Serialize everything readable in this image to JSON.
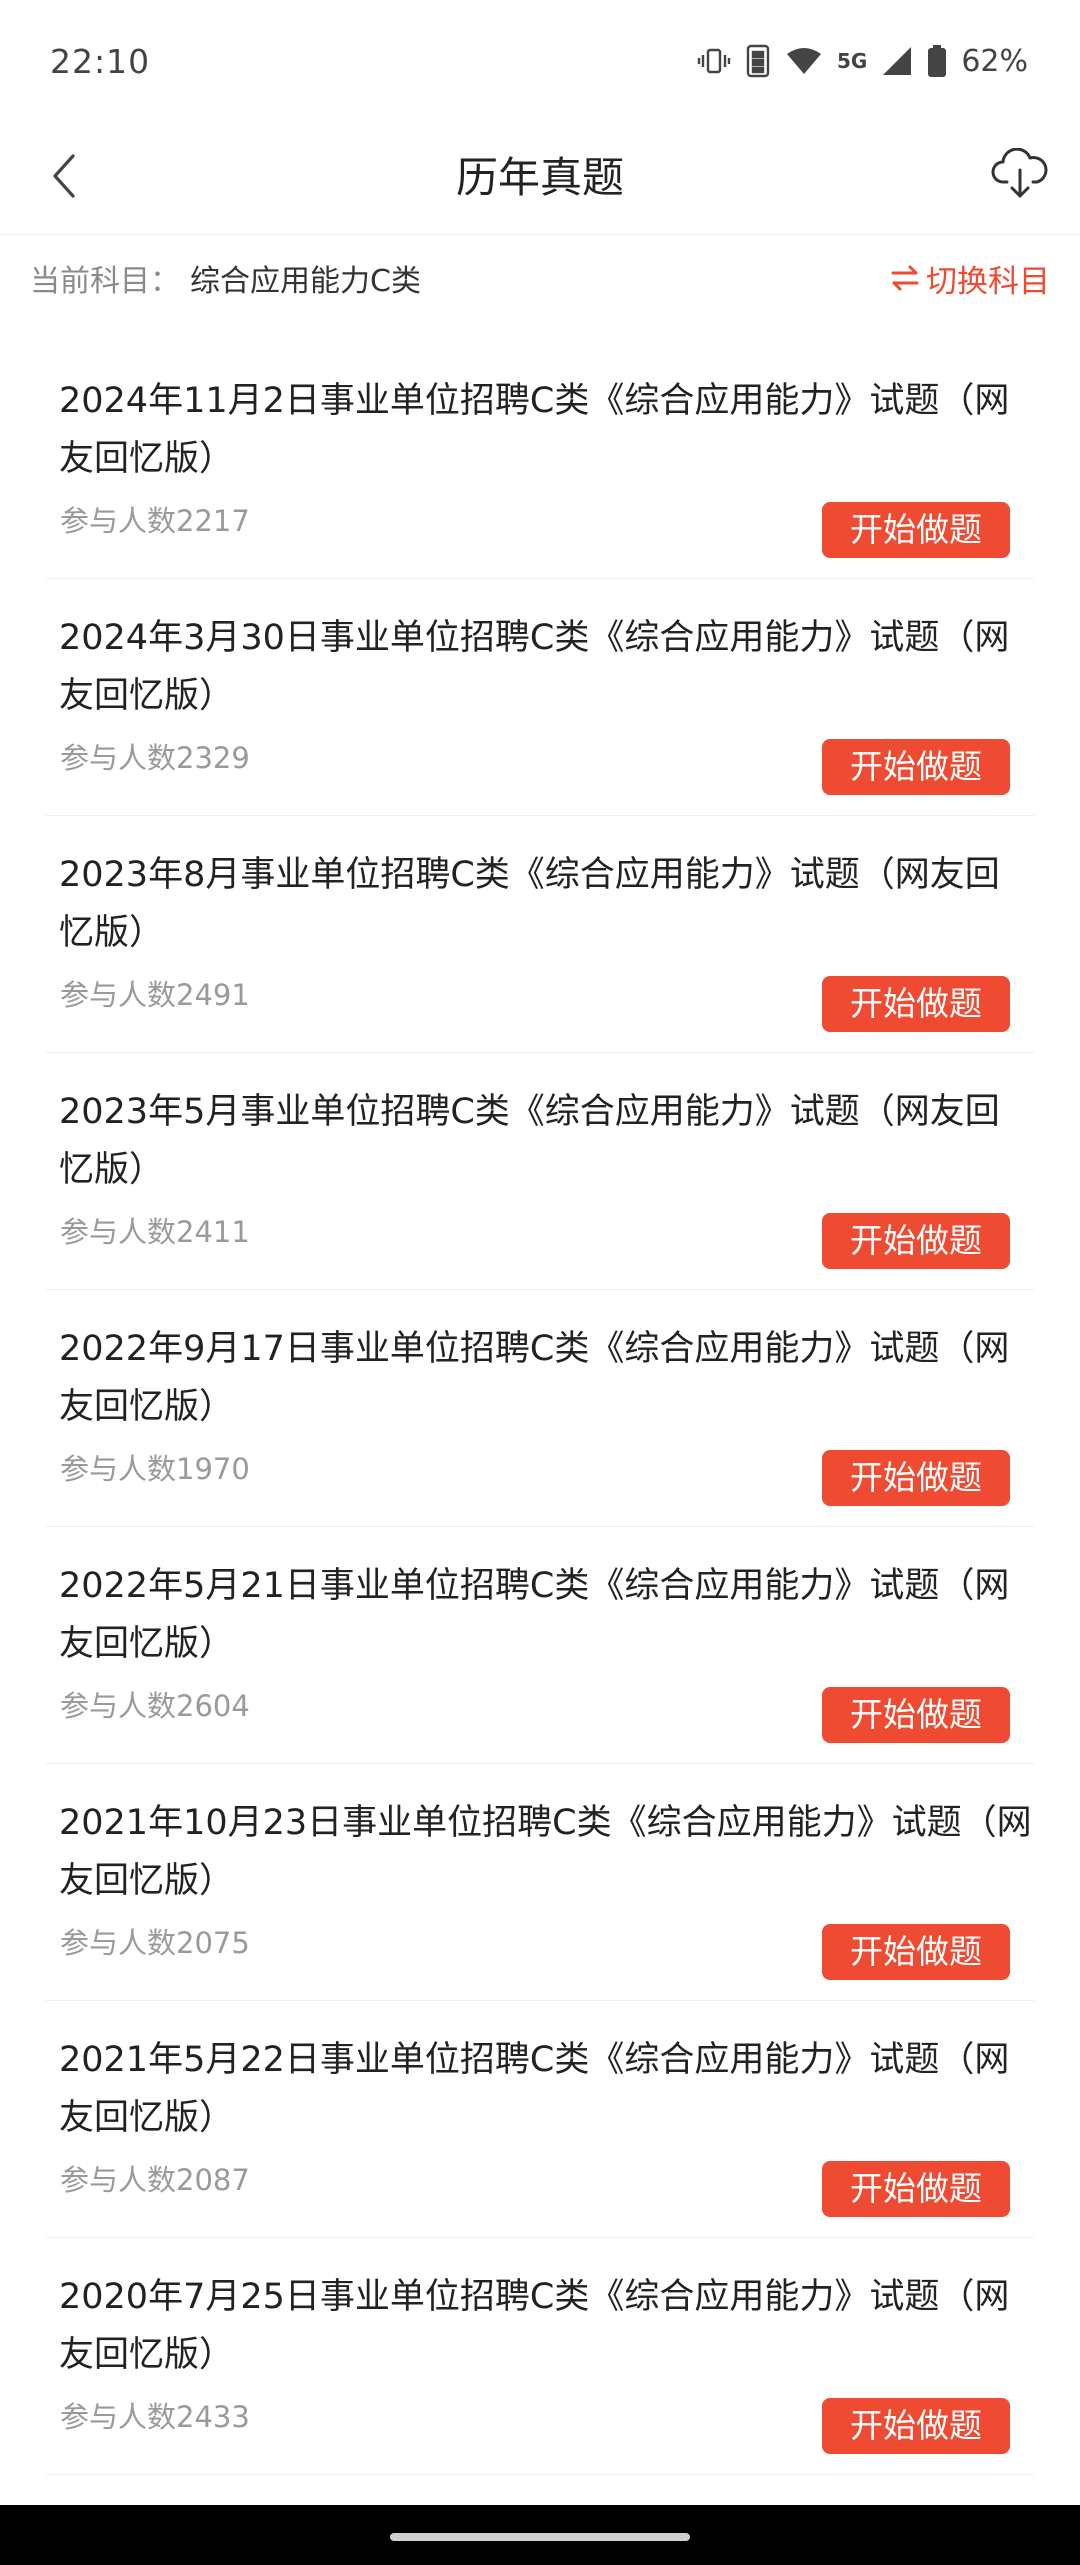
{
  "status_bar": {
    "time": "22:10",
    "network": "5G",
    "battery": "62%"
  },
  "nav": {
    "title": "历年真题",
    "back_icon": "chevron-left-icon",
    "download_icon": "cloud-download-icon"
  },
  "subject": {
    "label": "当前科目：",
    "name": "综合应用能力C类",
    "switch_label": "切换科目",
    "switch_icon": "swap-arrows-icon",
    "accent_color": "#ef4a32"
  },
  "exams": [
    {
      "title": "2024年11月2日事业单位招聘C类《综合应用能力》试题（网友回忆版）",
      "participants": "参与人数2217",
      "button": "开始做题"
    },
    {
      "title": "2024年3月30日事业单位招聘C类《综合应用能力》试题（网友回忆版）",
      "participants": "参与人数2329",
      "button": "开始做题"
    },
    {
      "title": "2023年8月事业单位招聘C类《综合应用能力》试题（网友回忆版）",
      "participants": "参与人数2491",
      "button": "开始做题"
    },
    {
      "title": "2023年5月事业单位招聘C类《综合应用能力》试题（网友回忆版）",
      "participants": "参与人数2411",
      "button": "开始做题"
    },
    {
      "title": "2022年9月17日事业单位招聘C类《综合应用能力》试题（网友回忆版）",
      "participants": "参与人数1970",
      "button": "开始做题"
    },
    {
      "title": "2022年5月21日事业单位招聘C类《综合应用能力》试题（网友回忆版）",
      "participants": "参与人数2604",
      "button": "开始做题"
    },
    {
      "title": "2021年10月23日事业单位招聘C类《综合应用能力》试题（网友回忆版）",
      "participants": "参与人数2075",
      "button": "开始做题"
    },
    {
      "title": "2021年5月22日事业单位招聘C类《综合应用能力》试题（网友回忆版）",
      "participants": "参与人数2087",
      "button": "开始做题"
    },
    {
      "title": "2020年7月25日事业单位招聘C类《综合应用能力》试题（网友回忆版）",
      "participants": "参与人数2433",
      "button": "开始做题"
    }
  ]
}
